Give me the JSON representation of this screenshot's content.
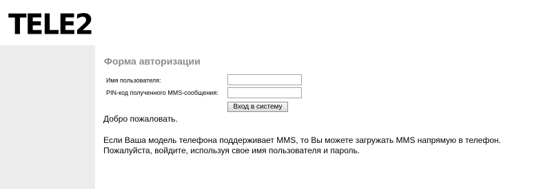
{
  "header": {
    "logo_text": "TELE2"
  },
  "form": {
    "title": "Форма авторизации",
    "username_label": "Имя пользователя:",
    "username_value": "",
    "pin_label": "PIN-код полученного MMS-сообщения:",
    "pin_value": "",
    "submit_label": "Вход в систему"
  },
  "content": {
    "welcome": "Добро пожаловать.",
    "info_line1": "Если Ваша модель телефона поддерживает MMS, то Вы можете загружать MMS напрямую в телефон.",
    "info_line2": "Пожалуйста, войдите, используя свое имя пользователя и пароль."
  },
  "colors": {
    "sidebar_bg": "#ececec",
    "title_gray": "#8a8a8a"
  }
}
